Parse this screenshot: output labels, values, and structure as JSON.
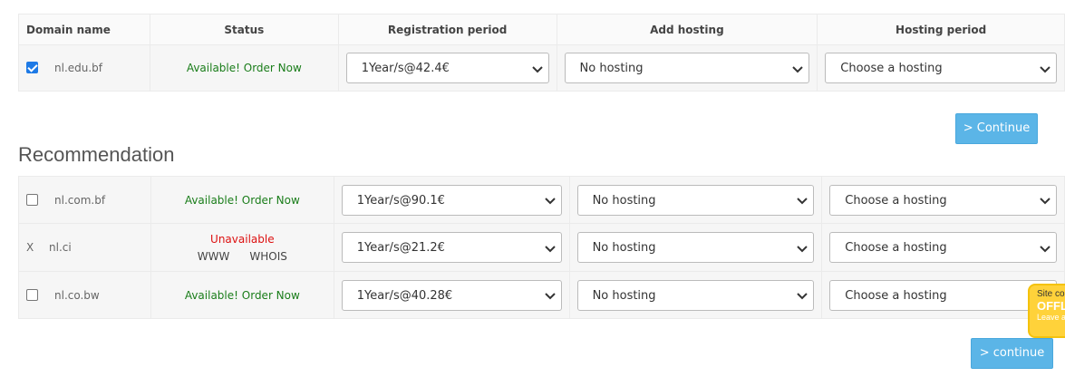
{
  "table_headers": {
    "domain_name": "Domain name",
    "status": "Status",
    "registration_period": "Registration period",
    "add_hosting": "Add hosting",
    "hosting_period": "Hosting period"
  },
  "main_row": {
    "domain": "nl.edu.bf",
    "checked": true,
    "status": "Available! Order Now",
    "registration": "1Year/s@42.4€",
    "hosting": "No hosting",
    "hosting_period": "Choose a hosting"
  },
  "continue_label": "> Continue",
  "recommendation_title": "Recommendation",
  "recommendations": [
    {
      "domain": "nl.com.bf",
      "status": "Available! Order Now",
      "registration": "1Year/s@90.1€",
      "hosting": "No hosting",
      "hosting_period": "Choose a hosting"
    },
    {
      "mark": "X",
      "domain": "nl.ci",
      "status": "Unavailable",
      "link_www": "WWW",
      "link_whois": "WHOIS",
      "registration": "1Year/s@21.2€",
      "hosting": "No hosting",
      "hosting_period": "Choose a hosting"
    },
    {
      "domain": "nl.co.bw",
      "status": "Available! Order Now",
      "registration": "1Year/s@40.28€",
      "hosting": "No hosting",
      "hosting_period": "Choose a hosting"
    }
  ],
  "continue2_label": "> continue",
  "chat_badge": {
    "line1": "Site co",
    "line2": "OFFLI",
    "line3": "Leave a"
  },
  "colors": {
    "button": "#5bb5e7",
    "available": "#1a7d1a",
    "unavailable": "#dd1111",
    "chat_badge": "#ffd23a"
  }
}
